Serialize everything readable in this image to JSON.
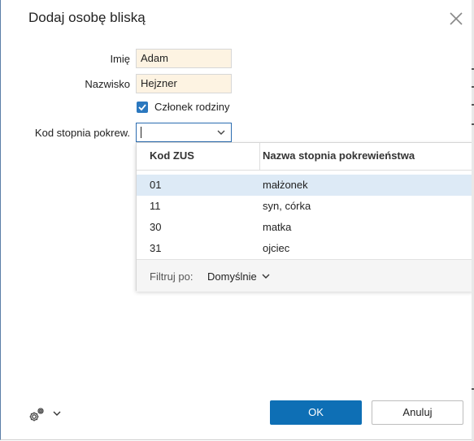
{
  "dialog": {
    "title": "Dodaj osobę bliską"
  },
  "form": {
    "first_name_label": "Imię",
    "first_name_value": "Adam",
    "last_name_label": "Nazwisko",
    "last_name_value": "Hejzner",
    "family_member_label": "Członek rodziny",
    "family_member_checked": true,
    "relation_code_label": "Kod stopnia pokrew.",
    "relation_code_value": ""
  },
  "dropdown": {
    "columns": [
      "Kod ZUS",
      "Nazwa stopnia pokrewieństwa"
    ],
    "rows": [
      {
        "code": "01",
        "name": "małżonek",
        "selected": true
      },
      {
        "code": "11",
        "name": "syn, córka",
        "selected": false
      },
      {
        "code": "30",
        "name": "matka",
        "selected": false
      },
      {
        "code": "31",
        "name": "ojciec",
        "selected": false
      }
    ],
    "filter_label": "Filtruj po:",
    "filter_value": "Domyślnie"
  },
  "footer": {
    "ok_label": "OK",
    "cancel_label": "Anuluj",
    "settings_icon": "gear-icon"
  },
  "colors": {
    "accent": "#0e6fb5",
    "input_bg": "#fdf3e2",
    "selected_row": "#ddeaf6"
  }
}
